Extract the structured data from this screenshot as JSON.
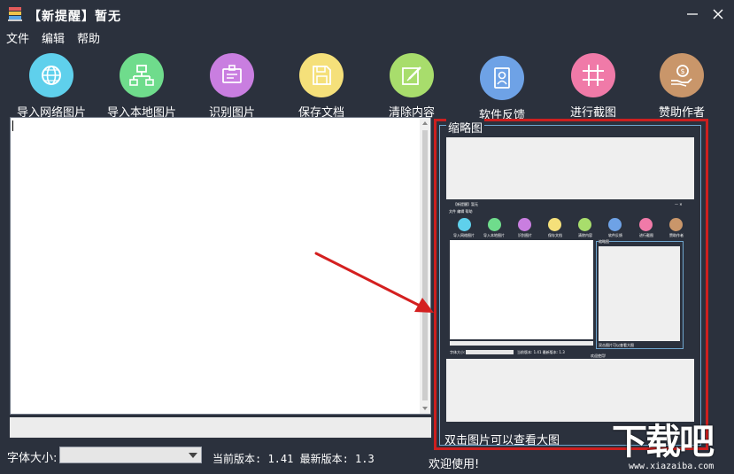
{
  "window": {
    "title": "【新提醒】暂无",
    "minimize_glyph": "—",
    "close_glyph": "✕"
  },
  "menu": [
    "文件",
    "编辑",
    "帮助"
  ],
  "toolbar": [
    {
      "label": "导入网络图片",
      "icon": "globe-network-icon",
      "color": "#5fd0ec"
    },
    {
      "label": "导入本地图片",
      "icon": "local-network-icon",
      "color": "#6fdc8c"
    },
    {
      "label": "识别图片",
      "icon": "id-card-icon",
      "color": "#c97ee0"
    },
    {
      "label": "保存文档",
      "icon": "save-disk-icon",
      "color": "#f5e07a"
    },
    {
      "label": "清除内容",
      "icon": "edit-pencil-icon",
      "color": "#a8dd6c"
    },
    {
      "label": "软件反馈",
      "icon": "contact-icon",
      "color": "#6ea2e6"
    },
    {
      "label": "进行截图",
      "icon": "crop-grid-icon",
      "color": "#f07aa8"
    },
    {
      "label": "赞助作者",
      "icon": "donate-hand-icon",
      "color": "#c9966a"
    }
  ],
  "bottom": {
    "font_size_label": "字体大小:",
    "version_text": "当前版本: 1.41 最新版本: 1.3",
    "welcome": "欢迎使用!"
  },
  "thumbnail": {
    "group_title": "缩略图",
    "hint": "双击图片可以查看大图"
  },
  "mini_screen": {
    "title": "【新提醒】暂无",
    "menu": "文件  编辑  帮助",
    "labels": [
      "导入网络图片",
      "导入本地图片",
      "识别图片",
      "保存文档",
      "清除内容",
      "软件反馈",
      "进行截图",
      "赞助作者"
    ],
    "thumb_title": "缩略图",
    "hint": "双击图片可以查看大图",
    "version": "当前版本: 1.41 最新版本: 1.3",
    "font_label": "字体大小:",
    "welcome": "欢迎使用!"
  },
  "watermark": {
    "main": "下载吧",
    "sub": "www.xiazaiba.com"
  },
  "colors": {
    "background": "#2b313d",
    "highlight_red": "#cc1f1f",
    "arrow_red": "#d42020"
  }
}
